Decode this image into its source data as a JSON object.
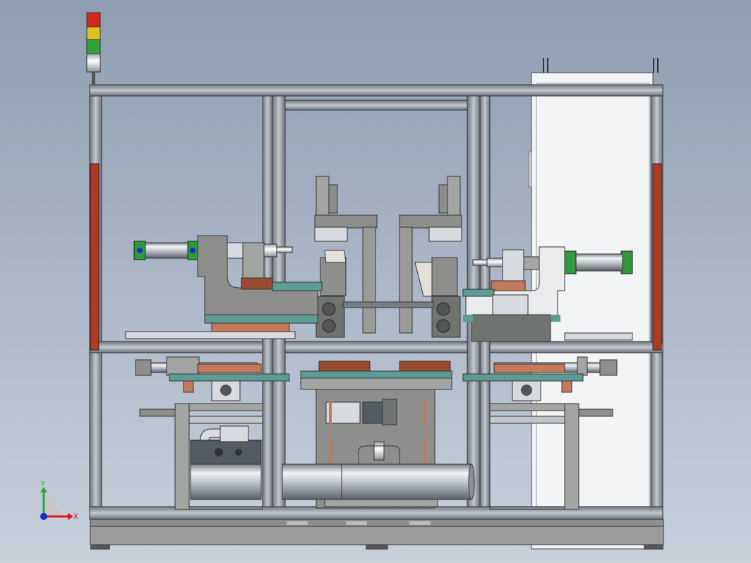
{
  "view": {
    "background_top": "#8e9db2",
    "background_bottom": "#c9d0dc"
  },
  "colors": {
    "frame_profile": "#9aa2ad",
    "frame_dark": "#4a4f57",
    "panel_white": "#f3f4f5",
    "guard_red": "#b23a23",
    "rail_teal": "#5d9c95",
    "pad_copper": "#c47a5a",
    "cylinder_green": "#2e9a3c",
    "plate_gray": "#8e8f8c",
    "steel_light": "#d7dbe0"
  },
  "tower_light": {
    "segments": [
      "red",
      "yellow",
      "green"
    ],
    "segment_colors": [
      "#d9261c",
      "#e0c21a",
      "#2fa33a"
    ]
  },
  "axis_triad": {
    "y_label": "Y",
    "x_label": "X",
    "y_color": "#2aa63a",
    "x_color": "#d21c1c",
    "origin_color": "#1a2fc8"
  }
}
